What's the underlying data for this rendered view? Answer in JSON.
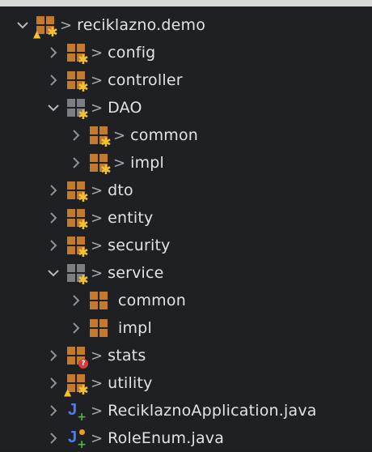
{
  "tree": {
    "root": {
      "label": "reciklazno.demo",
      "expanded": true,
      "icon": "package-warning-icon"
    },
    "items": [
      {
        "label": "config",
        "icon": "package-star-icon"
      },
      {
        "label": "controller",
        "icon": "package-star-icon"
      },
      {
        "label": "DAO",
        "icon": "package-grey-icon",
        "expanded": true
      },
      {
        "label": "common",
        "icon": "package-star-icon"
      },
      {
        "label": "impl",
        "icon": "package-star-icon"
      },
      {
        "label": "dto",
        "icon": "package-star-icon"
      },
      {
        "label": "entity",
        "icon": "package-star-icon"
      },
      {
        "label": "security",
        "icon": "package-star-icon"
      },
      {
        "label": "service",
        "icon": "package-grey-icon",
        "expanded": true
      },
      {
        "label": "common",
        "icon": "package-icon"
      },
      {
        "label": "impl",
        "icon": "package-icon"
      },
      {
        "label": "stats",
        "icon": "package-question-icon"
      },
      {
        "label": "utility",
        "icon": "package-warning-icon"
      },
      {
        "label": "ReciklaznoApplication.java",
        "icon": "java-class-icon"
      },
      {
        "label": "RoleEnum.java",
        "icon": "java-enum-icon"
      }
    ],
    "separator": ">"
  },
  "colors": {
    "background": "#1f2023",
    "text": "#e3e3e3",
    "package_orange": "#c47a2c",
    "package_grey": "#7b7f85",
    "star": "#f2c230",
    "java_blue": "#4c7cf6",
    "java_green": "#56b53f"
  }
}
